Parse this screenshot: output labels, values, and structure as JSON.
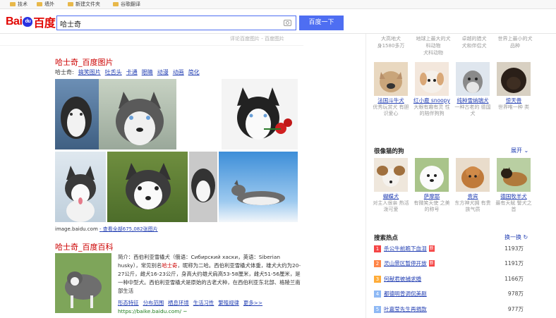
{
  "bookmarks": [
    "技术",
    "墙外",
    "新建文件夹",
    "谷歌翻译"
  ],
  "search": {
    "query": "哈士奇",
    "button": "百度一下"
  },
  "logo": {
    "left": "Bai",
    "paw": "du",
    "right": "百度"
  },
  "hint": "评论百度图片 - 百度图片",
  "image_result": {
    "title": "哈士奇_百度图片",
    "tags_label": "哈士奇:",
    "tags": [
      "搞笑图片",
      "吐舌头",
      "卡通",
      "眼睛",
      "动漫",
      "动画",
      "简化"
    ],
    "url": "image.baidu.com",
    "more": "- 查看全部675,082张图片"
  },
  "baike_result": {
    "title": "哈士奇_百度百科",
    "desc_pre": "简介：西伯利亚雪橇犬（俄语：Сибирский хаски，英语：Siberian husky），常见别名",
    "desc_hl": "哈士奇",
    "desc_post": "，昵称为二哈。西伯利亚雪橇犬体重，雄犬大约为20-27公斤，雌犬16-23公斤，身高大约雄犬肩高53-58厘米，雌犬51-56厘米，是一种中型犬。西伯利亚雪橇犬是原始的古老犬种，在西伯利亚东北部、格陵兰南部生活",
    "links": [
      "形态特征",
      "分布范围",
      "栖息环境",
      "生活习性",
      "繁殖规律",
      "更多>>"
    ],
    "url": "https://baike.baidu.com/ ~"
  },
  "right_top_names": [
    "大高地犬",
    "地球上最大的犬科动物",
    "卓越的猎犬",
    "世界上最小的犬"
  ],
  "right_top_descs": [
    "身1580多万",
    "犬科动物",
    "犬和伴侣犬",
    "品种"
  ],
  "right_dogs_row1": [
    {
      "name": "法国斗牛犬",
      "desc": "优秀玩赏犬 有胆识爱心"
    },
    {
      "name": "红小鹿 snoopy",
      "desc": "大眼有趣有灵 性的陪伴狗狗"
    },
    {
      "name": "纯种雪纳瑞犬",
      "desc": "一种古老的 德国犬"
    },
    {
      "name": "惊天兽",
      "desc": "世界唯一种 类"
    }
  ],
  "similar_section": {
    "title": "很像猫的狗",
    "expand": "展开"
  },
  "right_dogs_row2": [
    {
      "name": "蝴蝶犬",
      "desc": "对主人很亲 热活泼可爱"
    },
    {
      "name": "萨摩耶",
      "desc": "有微笑天使 之美的称号"
    },
    {
      "name": "贵宾",
      "desc": "东方神犬拥 有贵族气质"
    },
    {
      "name": "德国牧羊犬",
      "desc": "最有天赋 警犬之首"
    }
  ],
  "hot": {
    "title": "搜索热点",
    "change": "换一换",
    "items": [
      {
        "rank": "1",
        "title": "杀公牛前跪下血泪",
        "badge": "新",
        "count": "1193万"
      },
      {
        "rank": "2",
        "title": "灵山景区暂停开放",
        "badge": "新",
        "count": "1191万"
      },
      {
        "rank": "3",
        "title": "何献君被捕求婚",
        "badge": "",
        "count": "1166万"
      },
      {
        "rank": "4",
        "title": "都德明曾调侃美剧",
        "badge": "",
        "count": "978万"
      },
      {
        "rank": "5",
        "title": "叶嘉莹先生再捐款",
        "badge": "",
        "count": "977万"
      }
    ]
  },
  "colors": {
    "accent": "#4e6ef2",
    "link": "#2440b3",
    "title_red": "#cc0000",
    "rank1": "#f54545",
    "rank2": "#ff8547",
    "rank3": "#ffac38",
    "rank4": "#8eb9f5"
  }
}
